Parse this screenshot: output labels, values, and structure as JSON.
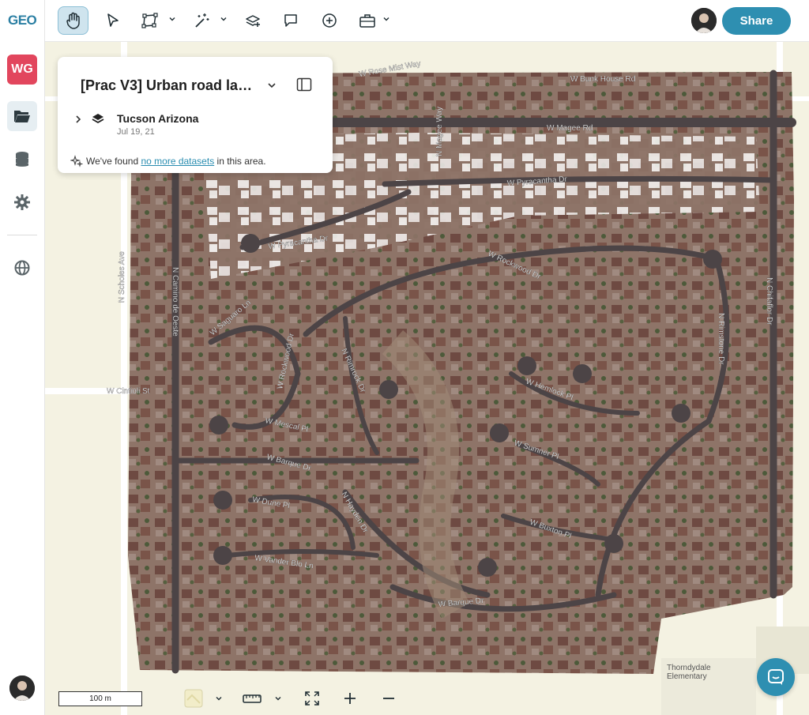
{
  "app": {
    "logo": "GEO",
    "workspace_initials": "WG"
  },
  "colors": {
    "accent": "#2e8fb1",
    "workspace": "#e2465d",
    "active_tool_bg": "#cfe4ee"
  },
  "toolbar": {
    "tools": [
      "hand-icon",
      "pointer-icon",
      "polygon-icon",
      "magic-wand-icon",
      "layer-add-icon",
      "comment-icon",
      "add-marker-icon",
      "toolbox-icon"
    ],
    "share_label": "Share"
  },
  "sidebar": {
    "items": [
      "folder-icon",
      "database-icon",
      "gear-icon",
      "globe-icon"
    ]
  },
  "project": {
    "title": "[Prac V3] Urban road lab…",
    "dataset_name": "Tucson Arizona",
    "dataset_date": "Jul 19, 21",
    "info_prefix": "We've found",
    "info_link": "no more datasets",
    "info_suffix": "in this area."
  },
  "bottom": {
    "scale_label": "100 m"
  },
  "map": {
    "roads": [
      "W Rose Mist Way",
      "W Magee Rd",
      "W Bunk House Rd",
      "N Magee Way",
      "W Pyracantha Dr",
      "W Pyracantha Dr",
      "W Rockwood Dr",
      "N Scholes Ave",
      "N Camino de Oeste",
      "W Cintioli St",
      "W Saguaro Ln",
      "W Rockwood Dr",
      "N Rimrock Dr",
      "W Mescal Pl",
      "W Barque Dr",
      "W Dune Pl",
      "N Hayden Dr",
      "W Vander Blo Ln",
      "W Barque Dr",
      "W Hemlock Pl",
      "W Sumner Pl",
      "W Buxton Pl",
      "N Rimstone Dr",
      "N Chifaflor Dr"
    ],
    "place_label_line1": "Thorndydale",
    "place_label_line2": "Elementary"
  }
}
